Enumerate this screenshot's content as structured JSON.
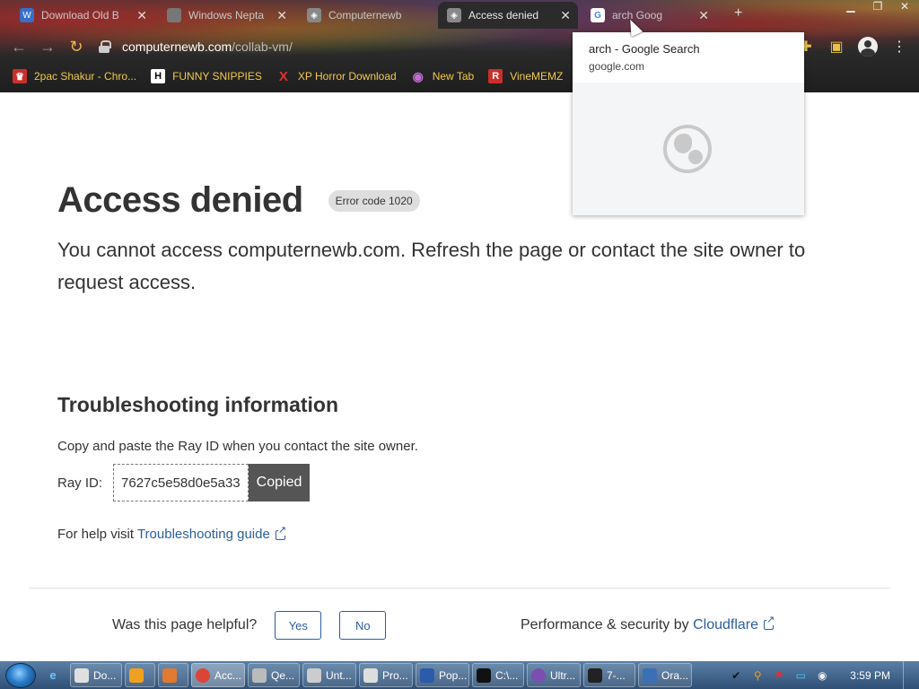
{
  "browser": {
    "tabs": [
      {
        "label": "Download Old B",
        "active": false,
        "icon_color": "#3a6fc8"
      },
      {
        "label": "Windows Nepta",
        "active": false,
        "icon_color": "#777777"
      },
      {
        "label": "Computernewb",
        "active": false,
        "icon_color": "#888888"
      },
      {
        "label": "Access denied",
        "active": true,
        "icon_color": "#888888"
      },
      {
        "label": "arch Goog",
        "active": false,
        "icon_color": "#ffffff"
      }
    ],
    "address": {
      "host": "computernewb.com",
      "path": "/collab-vm/"
    },
    "bookmarks": [
      {
        "label": "2pac Shakur - Chro...",
        "icon": "♛",
        "icon_bg": "#c9302c"
      },
      {
        "label": "FUNNY SNIPPIES",
        "icon": "H",
        "icon_bg": "#ffffff"
      },
      {
        "label": "XP Horror Download",
        "icon": "X",
        "icon_bg": "transparent"
      },
      {
        "label": "New Tab",
        "icon": "◉",
        "icon_bg": "transparent"
      },
      {
        "label": "VineMEMZ",
        "icon": "R",
        "icon_bg": "#c9302c"
      }
    ],
    "suggestion": {
      "title": "arch - Google Search",
      "url": "google.com"
    }
  },
  "page": {
    "title": "Access denied",
    "error_code": "Error code 1020",
    "lead": "You cannot access computernewb.com. Refresh the page or contact the site owner to request access.",
    "troubleshooting": {
      "heading": "Troubleshooting information",
      "instructions": "Copy and paste the Ray ID when you contact the site owner.",
      "ray_label": "Ray ID:",
      "ray_id": "7627c5e58d0e5a33",
      "copy_button": "Copied",
      "help_prefix": "For help visit",
      "help_link": "Troubleshooting guide"
    },
    "feedback": {
      "question": "Was this page helpful?",
      "yes": "Yes",
      "no": "No"
    },
    "footer": {
      "prefix": "Performance & security by",
      "link": "Cloudflare"
    }
  },
  "taskbar": {
    "items": [
      {
        "label": "Do...",
        "active": false,
        "icon_color": "#e0e0e0"
      },
      {
        "label": "",
        "active": false,
        "icon_color": "#f0a020"
      },
      {
        "label": "",
        "active": false,
        "icon_color": "#e07a30"
      },
      {
        "label": "Acc...",
        "active": true,
        "icon_color": "#db4437"
      },
      {
        "label": "Qe...",
        "active": false,
        "icon_color": "#bbbbbb"
      },
      {
        "label": "Unt...",
        "active": false,
        "icon_color": "#cccccc"
      },
      {
        "label": "Pro...",
        "active": false,
        "icon_color": "#dddddd"
      },
      {
        "label": "Pop...",
        "active": false,
        "icon_color": "#2a5caa"
      },
      {
        "label": "C:\\...",
        "active": false,
        "icon_color": "#111111"
      },
      {
        "label": "Ultr...",
        "active": false,
        "icon_color": "#7a4fb0"
      },
      {
        "label": "7-...",
        "active": false,
        "icon_color": "#222222"
      },
      {
        "label": "Ora...",
        "active": false,
        "icon_color": "#3b6fb6"
      }
    ],
    "clock": "3:59 PM"
  }
}
